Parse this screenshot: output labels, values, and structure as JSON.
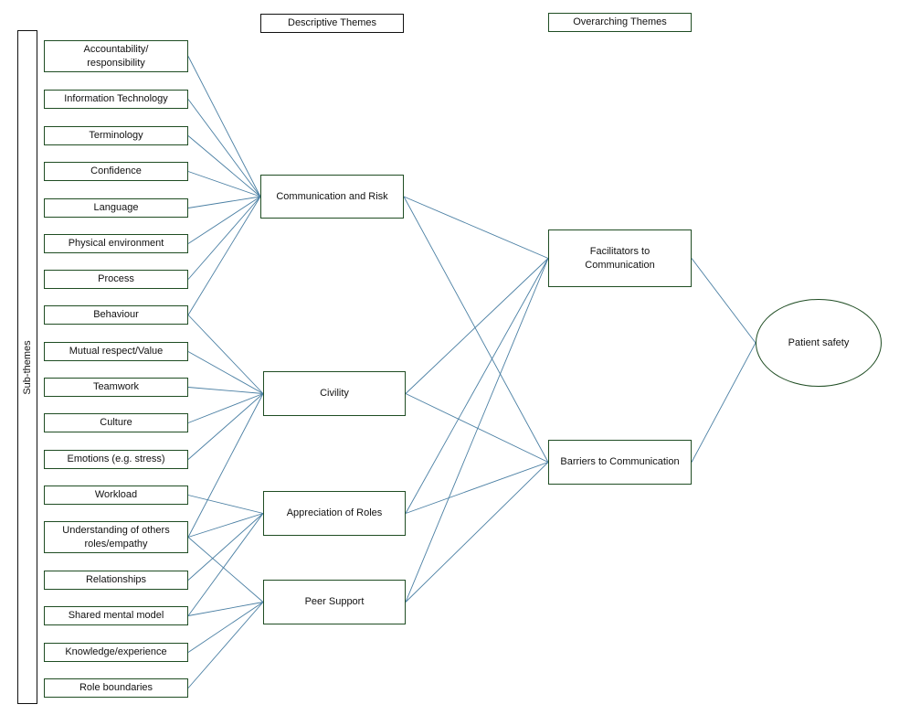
{
  "headers": {
    "descriptive": "Descriptive Themes",
    "overarching": "Overarching Themes",
    "sub_themes": "Sub-themes"
  },
  "sub_themes": [
    {
      "id": "s0",
      "label": "Accountability/ responsibility",
      "lines": [
        "Accountability/",
        "responsibility"
      ]
    },
    {
      "id": "s1",
      "label": "Information Technology"
    },
    {
      "id": "s2",
      "label": "Terminology"
    },
    {
      "id": "s3",
      "label": "Confidence"
    },
    {
      "id": "s4",
      "label": "Language"
    },
    {
      "id": "s5",
      "label": "Physical environment"
    },
    {
      "id": "s6",
      "label": "Process"
    },
    {
      "id": "s7",
      "label": "Behaviour"
    },
    {
      "id": "s8",
      "label": "Mutual respect/Value"
    },
    {
      "id": "s9",
      "label": "Teamwork"
    },
    {
      "id": "s10",
      "label": "Culture"
    },
    {
      "id": "s11",
      "label": "Emotions (e.g. stress)"
    },
    {
      "id": "s12",
      "label": "Workload"
    },
    {
      "id": "s13",
      "label": "Understanding of others roles/empathy",
      "lines": [
        "Understanding of others",
        "roles/empathy"
      ]
    },
    {
      "id": "s14",
      "label": "Relationships"
    },
    {
      "id": "s15",
      "label": "Shared mental model"
    },
    {
      "id": "s16",
      "label": "Knowledge/experience"
    },
    {
      "id": "s17",
      "label": "Role boundaries"
    }
  ],
  "descriptive_themes": [
    {
      "id": "d0",
      "label": "Communication and Risk"
    },
    {
      "id": "d1",
      "label": "Civility"
    },
    {
      "id": "d2",
      "label": "Appreciation of Roles"
    },
    {
      "id": "d3",
      "label": "Peer Support"
    }
  ],
  "overarching_themes": [
    {
      "id": "o0",
      "label": "Facilitators to Communication",
      "lines": [
        "Facilitators to",
        "Communication"
      ]
    },
    {
      "id": "o1",
      "label": "Barriers to Communication"
    }
  ],
  "outcome": {
    "id": "p0",
    "label": "Patient safety"
  },
  "edges": [
    [
      "s0",
      "d0"
    ],
    [
      "s1",
      "d0"
    ],
    [
      "s2",
      "d0"
    ],
    [
      "s3",
      "d0"
    ],
    [
      "s4",
      "d0"
    ],
    [
      "s5",
      "d0"
    ],
    [
      "s6",
      "d0"
    ],
    [
      "s7",
      "d0"
    ],
    [
      "s7",
      "d1"
    ],
    [
      "s8",
      "d1"
    ],
    [
      "s9",
      "d1"
    ],
    [
      "s10",
      "d1"
    ],
    [
      "s11",
      "d1"
    ],
    [
      "s13",
      "d1"
    ],
    [
      "s12",
      "d2"
    ],
    [
      "s13",
      "d2"
    ],
    [
      "s14",
      "d2"
    ],
    [
      "s15",
      "d2"
    ],
    [
      "s13",
      "d3"
    ],
    [
      "s15",
      "d3"
    ],
    [
      "s16",
      "d3"
    ],
    [
      "s17",
      "d3"
    ],
    [
      "d0",
      "o0"
    ],
    [
      "d0",
      "o1"
    ],
    [
      "d1",
      "o0"
    ],
    [
      "d1",
      "o1"
    ],
    [
      "d2",
      "o0"
    ],
    [
      "d2",
      "o1"
    ],
    [
      "d3",
      "o0"
    ],
    [
      "d3",
      "o1"
    ],
    [
      "o0",
      "p0"
    ],
    [
      "o1",
      "p0"
    ]
  ],
  "colors": {
    "box_border": "#1f4d23",
    "line": "#4a7fa3",
    "header_border_dark": "#111111"
  }
}
